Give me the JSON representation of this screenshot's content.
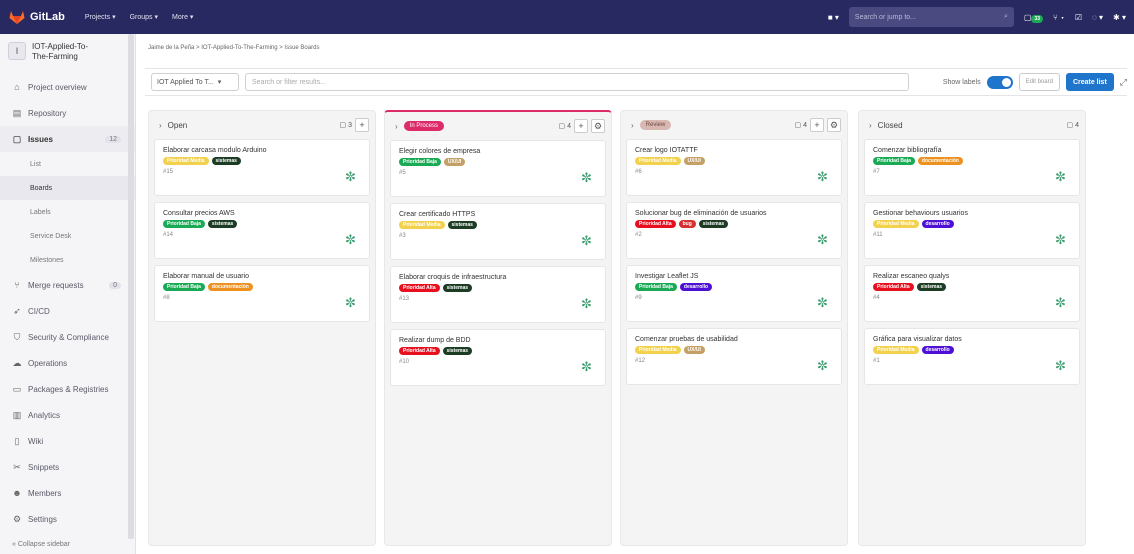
{
  "topbar": {
    "brand": "GitLab",
    "nav": [
      "Projects ▾",
      "Groups ▾",
      "More ▾"
    ],
    "search_placeholder": "Search or jump to...",
    "mr_count": "33"
  },
  "sidebar": {
    "project_initial": "I",
    "project_name": "IOT-Applied-To-The-Farming",
    "items": [
      {
        "label": "Project overview",
        "icon": "house-icon"
      },
      {
        "label": "Repository",
        "icon": "book-icon"
      },
      {
        "label": "Issues",
        "icon": "issues-icon",
        "count": "12"
      },
      {
        "label": "Merge requests",
        "icon": "merge-request-icon",
        "count": "0"
      },
      {
        "label": "CI/CD",
        "icon": "rocket-icon"
      },
      {
        "label": "Security & Compliance",
        "icon": "shield-icon"
      },
      {
        "label": "Operations",
        "icon": "cloud-icon"
      },
      {
        "label": "Packages & Registries",
        "icon": "package-icon"
      },
      {
        "label": "Analytics",
        "icon": "chart-icon"
      },
      {
        "label": "Wiki",
        "icon": "book-icon"
      },
      {
        "label": "Snippets",
        "icon": "scissors-icon"
      },
      {
        "label": "Members",
        "icon": "users-icon"
      },
      {
        "label": "Settings",
        "icon": "gear-icon"
      }
    ],
    "issues_sub": [
      "List",
      "Boards",
      "Labels",
      "Service Desk",
      "Milestones"
    ],
    "collapse": "Collapse sidebar"
  },
  "breadcrumb": [
    "Jaime de la Peña",
    "IOT-Applied-To-The-Farming",
    "Issue Boards"
  ],
  "filter": {
    "project": "IOT Applied To T...",
    "search_placeholder": "Search or filter results...",
    "show_labels": "Show labels",
    "edit_board": "Edit board",
    "create_list": "Create list"
  },
  "colors": {
    "prio_low": "#1aaa55",
    "prio_mid": "#f1d14d",
    "prio_high": "#e8101f",
    "sistemas": "#1c3c24",
    "documentacion": "#ed9121",
    "ux": "#c4a066",
    "desarrollo": "#4d10d4",
    "bug": "#d63031",
    "in_process": "#dd2b69",
    "review": "#d8b8b0"
  },
  "boards": [
    {
      "name": "Open",
      "count": "3",
      "cards": [
        {
          "title": "Elaborar carcasa modulo Arduino",
          "labels": [
            "Prioridad Media",
            "sistemas"
          ],
          "num": "#15"
        },
        {
          "title": "Consultar precios AWS",
          "labels": [
            "Prioridad Baja",
            "sistemas"
          ],
          "num": "#14"
        },
        {
          "title": "Elaborar manual de usuario",
          "labels": [
            "Prioridad Baja",
            "documentación"
          ],
          "num": "#8"
        }
      ]
    },
    {
      "name": "In Process",
      "count": "4",
      "cards": [
        {
          "title": "Elegir colores de empresa",
          "labels": [
            "Prioridad Baja",
            "UX/UI"
          ],
          "num": "#5"
        },
        {
          "title": "Crear certificado HTTPS",
          "labels": [
            "Prioridad Media",
            "sistemas"
          ],
          "num": "#3"
        },
        {
          "title": "Elaborar croquis de infraestructura",
          "labels": [
            "Prioridad Alta",
            "sistemas"
          ],
          "num": "#13"
        },
        {
          "title": "Realizar dump de BDD",
          "labels": [
            "Prioridad Alta",
            "sistemas"
          ],
          "num": "#10"
        }
      ]
    },
    {
      "name": "Review",
      "count": "4",
      "cards": [
        {
          "title": "Crear logo IOTATTF",
          "labels": [
            "Prioridad Media",
            "UX/UI"
          ],
          "num": "#6"
        },
        {
          "title": "Solucionar bug de eliminación de usuarios",
          "labels": [
            "Prioridad Alta",
            "bug",
            "sistemas"
          ],
          "num": "#2"
        },
        {
          "title": "Investigar Leaflet JS",
          "labels": [
            "Prioridad Baja",
            "desarrollo"
          ],
          "num": "#9"
        },
        {
          "title": "Comenzar pruebas de usabilidad",
          "labels": [
            "Prioridad Media",
            "UX/UI"
          ],
          "num": "#12"
        }
      ]
    },
    {
      "name": "Closed",
      "count": "4",
      "cards": [
        {
          "title": "Comenzar bibliografía",
          "labels": [
            "Prioridad Baja",
            "documentación"
          ],
          "num": "#7"
        },
        {
          "title": "Gestionar behaviours usuarios",
          "labels": [
            "Prioridad Media",
            "desarrollo"
          ],
          "num": "#11"
        },
        {
          "title": "Realizar escaneo qualys",
          "labels": [
            "Prioridad Alta",
            "sistemas"
          ],
          "num": "#4"
        },
        {
          "title": "Gráfica para visualizar datos",
          "labels": [
            "Prioridad Media",
            "desarrollo"
          ],
          "num": "#1"
        }
      ]
    }
  ]
}
